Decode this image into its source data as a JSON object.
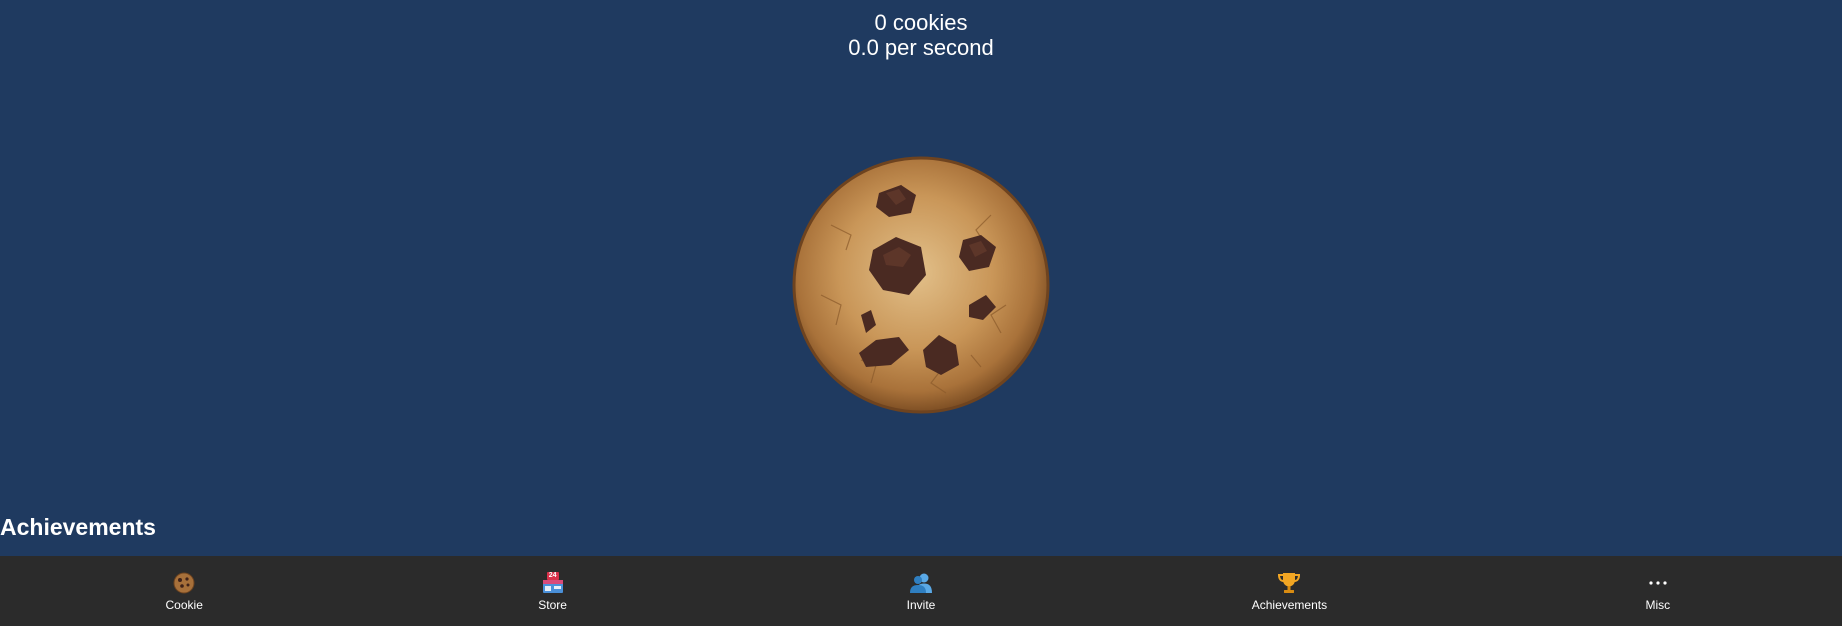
{
  "stats": {
    "cookies": "0 cookies",
    "per_second": "0.0 per second"
  },
  "main": {
    "cookie_icon": "big-cookie",
    "section_title": "Achievements"
  },
  "nav": {
    "items": [
      {
        "label": "Cookie",
        "icon": "cookie-icon"
      },
      {
        "label": "Store",
        "icon": "store-icon"
      },
      {
        "label": "Invite",
        "icon": "invite-icon"
      },
      {
        "label": "Achievements",
        "icon": "trophy-icon"
      },
      {
        "label": "Misc",
        "icon": "more-icon"
      }
    ],
    "store_badge": "24"
  },
  "colors": {
    "background": "#1f3a60",
    "nav_background": "#2b2b2b",
    "text": "#ffffff",
    "cookie": "#b88444",
    "chocolate": "#4a2a22",
    "trophy": "#e69a1a",
    "invite": "#3d8fd1"
  }
}
